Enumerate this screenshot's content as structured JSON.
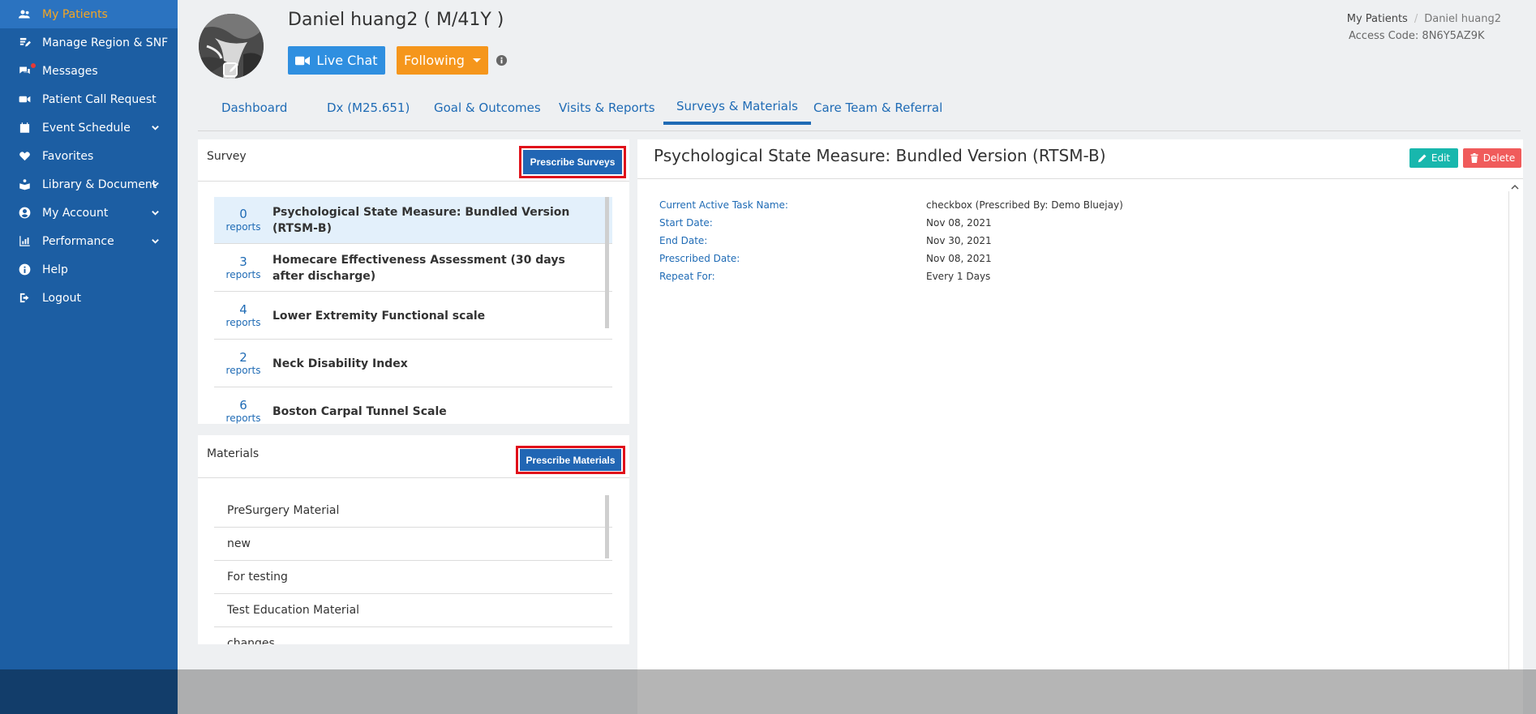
{
  "sidebar": {
    "items": [
      {
        "label": "My Patients",
        "icon": "users-icon"
      },
      {
        "label": "Manage Region & SNF",
        "icon": "edit-doc-icon"
      },
      {
        "label": "Messages",
        "icon": "chat-icon"
      },
      {
        "label": "Patient Call Request",
        "icon": "video-camera-icon"
      },
      {
        "label": "Event Schedule",
        "icon": "calendar-icon"
      },
      {
        "label": "Favorites",
        "icon": "heart-icon"
      },
      {
        "label": "Library & Document",
        "icon": "library-icon"
      },
      {
        "label": "My Account",
        "icon": "user-circle-icon"
      },
      {
        "label": "Performance",
        "icon": "bar-chart-icon"
      },
      {
        "label": "Help",
        "icon": "info-circle-icon"
      },
      {
        "label": "Logout",
        "icon": "logout-icon"
      }
    ]
  },
  "header": {
    "patient_name": "Daniel huang2 ( M/41Y )",
    "live_chat_label": "Live Chat",
    "following_label": "Following",
    "breadcrumb_root": "My Patients",
    "breadcrumb_separator": "/",
    "breadcrumb_current": "Daniel huang2",
    "access_code": "Access Code: 8N6Y5AZ9K"
  },
  "tabs": [
    {
      "label": "Dashboard"
    },
    {
      "label": "Dx (M25.651)"
    },
    {
      "label": "Goal & Outcomes"
    },
    {
      "label": "Visits & Reports"
    },
    {
      "label": "Surveys & Materials"
    },
    {
      "label": "Care Team & Referral"
    }
  ],
  "survey": {
    "title": "Survey",
    "prescribe_label": "Prescribe Surveys",
    "items": [
      {
        "count": "0",
        "unit": "reports",
        "name": "Psychological State Measure: Bundled Version (RTSM-B)"
      },
      {
        "count": "3",
        "unit": "reports",
        "name": "Homecare Effectiveness Assessment (30 days after discharge)"
      },
      {
        "count": "4",
        "unit": "reports",
        "name": "Lower Extremity Functional scale"
      },
      {
        "count": "2",
        "unit": "reports",
        "name": "Neck Disability Index"
      },
      {
        "count": "6",
        "unit": "reports",
        "name": "Boston Carpal Tunnel Scale"
      }
    ]
  },
  "materials": {
    "title": "Materials",
    "prescribe_label": "Prescribe Materials",
    "items": [
      "PreSurgery Material",
      "new",
      "For testing",
      "Test Education Material",
      "changes"
    ]
  },
  "detail": {
    "title": "Psychological State Measure: Bundled Version (RTSM-B)",
    "edit_label": "Edit",
    "delete_label": "Delete",
    "fields": [
      {
        "label": "Current Active Task Name:",
        "value": "checkbox (Prescribed By: Demo Bluejay)"
      },
      {
        "label": "Start Date:",
        "value": "Nov 08, 2021"
      },
      {
        "label": "End Date:",
        "value": "Nov 30, 2021"
      },
      {
        "label": "Prescribed Date:",
        "value": "Nov 08, 2021"
      },
      {
        "label": "Repeat For:",
        "value": "Every 1 Days"
      }
    ]
  },
  "colors": {
    "sidebar_bg": "#1c5ea3",
    "active_nav_text": "#f5a623",
    "primary_blue": "#1f6bb5",
    "live_chat": "#2f8fe0",
    "following": "#f5961c",
    "edit": "#18b7ad",
    "delete": "#f05b5b",
    "highlight_border": "#e0101a"
  }
}
